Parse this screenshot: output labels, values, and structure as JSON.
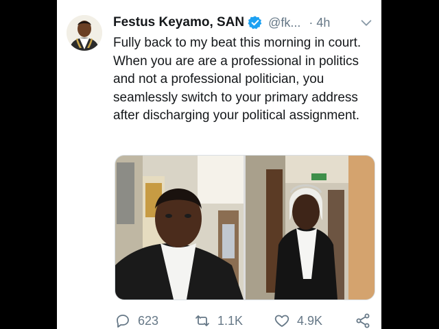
{
  "tweet": {
    "author_name": "Festus Keyamo, SAN",
    "handle": "@fk...",
    "separator": "·",
    "time": "4h",
    "text": "Fully back to my beat this morning in court. When you are are a professional in politics and not a professional politician, you seamlessly switch to your primary address after discharging your political assignment."
  },
  "icons": {
    "verified": "verified-badge-icon",
    "menu": "chevron-down-icon",
    "reply": "reply-icon",
    "retweet": "retweet-icon",
    "like": "heart-icon",
    "share": "share-icon"
  },
  "actions": {
    "replies": "623",
    "retweets": "1.1K",
    "likes": "4.9K"
  },
  "colors": {
    "verified": "#1da1f2",
    "secondary_text": "#657786",
    "primary_text": "#14171a"
  }
}
